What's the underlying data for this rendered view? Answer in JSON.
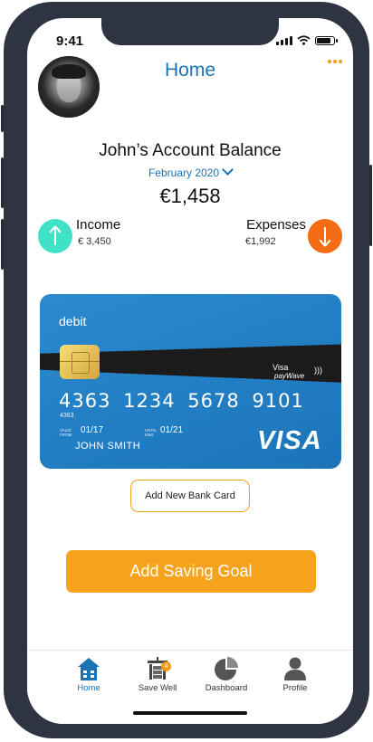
{
  "status_bar": {
    "time": "9:41"
  },
  "header": {
    "title": "Home"
  },
  "account": {
    "balance_label": "John’s Account Balance",
    "month": "February 2020",
    "balance": "€1,458"
  },
  "income": {
    "label": "Income",
    "value": "€ 3,450"
  },
  "expenses": {
    "label": "Expenses",
    "value": "€1,992"
  },
  "card": {
    "type_label": "debit",
    "paywave_line1": "Visa",
    "paywave_line2": "payWave",
    "number": "4363 1234 5678 9101",
    "number_small": "4363",
    "valid_from_label": "VALID FROM",
    "valid_from": "01/17",
    "valid_until_label": "UNTIL END",
    "valid_until": "01/21",
    "holder": "JOHN SMITH",
    "brand": "VISA"
  },
  "buttons": {
    "add_card": "Add New Bank Card",
    "add_goal": "Add Saving Goal"
  },
  "tabs": [
    {
      "label": "Home",
      "icon": "house-icon",
      "active": true
    },
    {
      "label": "Save Well",
      "icon": "savings-icon",
      "badge": "4"
    },
    {
      "label": "Dashboard",
      "icon": "pie-chart-icon"
    },
    {
      "label": "Profile",
      "icon": "user-icon"
    }
  ],
  "colors": {
    "primary_blue": "#1a73b5",
    "accent_orange": "#f7a31d",
    "income_teal": "#3fe2c7",
    "expense_orange": "#f36b14",
    "card_blue": "#2184c9"
  }
}
